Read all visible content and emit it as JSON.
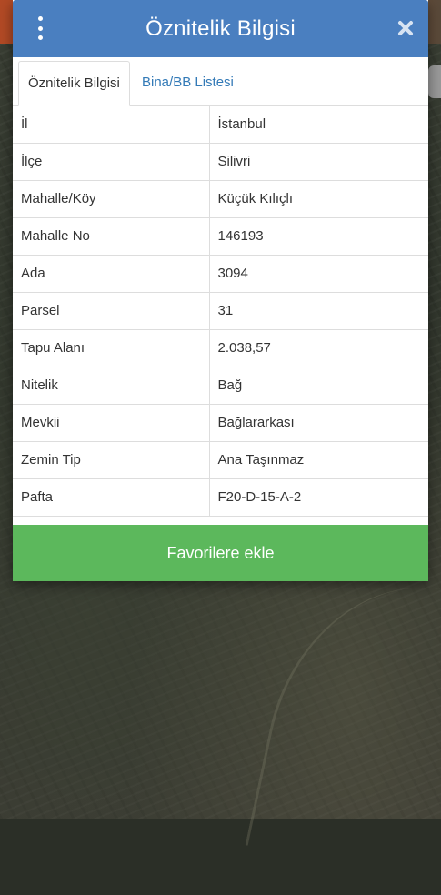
{
  "dialog": {
    "title": "Öznitelik Bilgisi",
    "menu_icon": "vertical-dots-icon",
    "close_icon": "close-icon"
  },
  "tabs": [
    {
      "label": "Öznitelik Bilgisi",
      "active": true
    },
    {
      "label": "Bina/BB Listesi",
      "active": false
    }
  ],
  "attributes": [
    {
      "key": "İl",
      "value": "İstanbul"
    },
    {
      "key": "İlçe",
      "value": "Silivri"
    },
    {
      "key": "Mahalle/Köy",
      "value": "Küçük Kılıçlı"
    },
    {
      "key": "Mahalle No",
      "value": "146193"
    },
    {
      "key": "Ada",
      "value": "3094"
    },
    {
      "key": "Parsel",
      "value": "31"
    },
    {
      "key": "Tapu Alanı",
      "value": "2.038,57"
    },
    {
      "key": "Nitelik",
      "value": "Bağ"
    },
    {
      "key": "Mevkii",
      "value": "Bağlararkası"
    },
    {
      "key": "Zemin Tip",
      "value": "Ana Taşınmaz"
    },
    {
      "key": "Pafta",
      "value": "F20-D-15-A-2"
    }
  ],
  "actions": {
    "favorite_label": "Favorilere ekle"
  },
  "colors": {
    "header": "#4a7fc0",
    "tab_link": "#337ab7",
    "favorite_button": "#5cb85c"
  }
}
